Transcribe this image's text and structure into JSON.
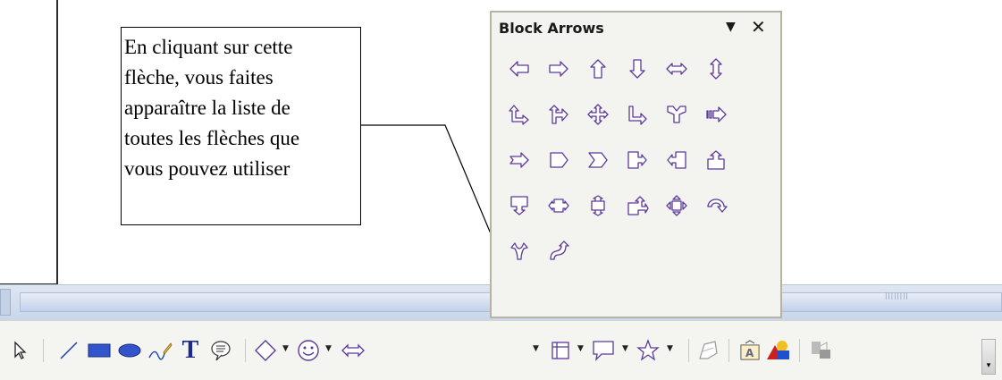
{
  "callout": {
    "lines": [
      "En cliquant sur cette",
      "flèche, vous faites",
      "apparaître la liste de",
      "toutes les flèches que",
      "vous pouvez utiliser"
    ]
  },
  "panel": {
    "title": "Block Arrows",
    "menu_icon": "dropdown-triangle-icon",
    "close_icon": "close-icon",
    "close_glyph": "✕",
    "menu_glyph": "▼",
    "shapes": [
      "left-arrow",
      "right-arrow",
      "up-arrow",
      "down-arrow",
      "left-right-arrow",
      "up-down-arrow",
      "up-right-arrow",
      "up-right-down-arrow",
      "4-way-arrow",
      "corner-right-arrow",
      "split-arrow",
      "striped-right-arrow",
      "notched-right-arrow",
      "pentagon",
      "chevron",
      "right-arrow-callout",
      "left-arrow-callout",
      "up-arrow-callout",
      "down-arrow-callout",
      "left-right-arrow-callout",
      "up-down-arrow-callout",
      "up-right-arrow-callout",
      "4-way-arrow-callout",
      "circular-arrow",
      "split-round-arrow",
      "s-shaped-arrow"
    ]
  },
  "toolbar": {
    "items": [
      "select-icon",
      "line-icon",
      "rectangle-icon",
      "ellipse-icon",
      "freeform-line-icon",
      "text-icon",
      "callout-text-icon",
      "basic-shapes-icon",
      "symbol-shapes-icon",
      "block-arrows-icon",
      "flowchart-icon",
      "callouts-icon",
      "stars-icon",
      "points-icon",
      "fontwork-icon",
      "from-file-icon",
      "extrusion-icon"
    ],
    "overflow_glyph": "▾"
  },
  "colors": {
    "accent_purple": "#5b3a9a",
    "rect_blue": "#3355cc",
    "panel_bg": "#f3f3ef",
    "toolbar_bg": "#f4f4f1"
  }
}
